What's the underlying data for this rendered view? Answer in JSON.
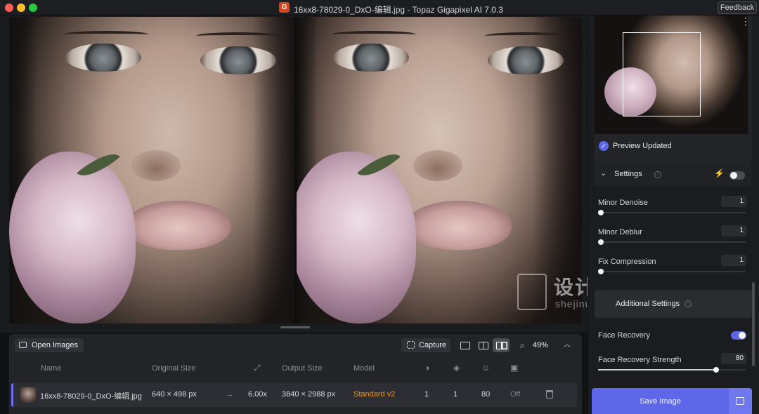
{
  "window": {
    "title": "16xx8-78029-0_DxO-编辑.jpg - Topaz Gigapixel AI 7.0.3",
    "app_logo_letter": "G",
    "feedback_label": "Feedback"
  },
  "toolbar": {
    "open_images_label": "Open Images",
    "capture_label": "Capture",
    "zoom_value": "49%",
    "view_modes": [
      "single-view",
      "split-view",
      "side-by-side"
    ],
    "active_view_mode": "side-by-side"
  },
  "table": {
    "columns": {
      "name": "Name",
      "original_size": "Original Size",
      "output_size": "Output Size",
      "model": "Model"
    },
    "column_icons": [
      "expand-arrows-icon",
      "denoise-icon",
      "deblur-icon",
      "face-icon",
      "compression-icon"
    ],
    "rows": [
      {
        "name": "16xx8-78029-0_DxO-编辑.jpg",
        "original_size": "640 × 498 px",
        "scale": "6.00x",
        "output_size": "3840 × 2988 px",
        "model": "Standard v2",
        "denoise": "1",
        "deblur": "1",
        "face": "80",
        "compression": "Off"
      }
    ]
  },
  "sidebar": {
    "preview_status": "Preview Updated",
    "settings": {
      "title": "Settings",
      "auto_toggle_on": false,
      "params": [
        {
          "label": "Minor Denoise",
          "value": "1",
          "level": 0.0
        },
        {
          "label": "Minor Deblur",
          "value": "1",
          "level": 0.0
        },
        {
          "label": "Fix Compression",
          "value": "1",
          "level": 0.0
        }
      ]
    },
    "additional_settings": {
      "title": "Additional Settings",
      "face_recovery_label": "Face Recovery",
      "face_recovery_on": true,
      "face_recovery_strength_label": "Face Recovery Strength",
      "face_recovery_strength_value": "80",
      "face_recovery_strength_level": 0.8
    },
    "save_label": "Save Image"
  },
  "watermark": {
    "text": "设计奴",
    "subtext": "shejinu.com"
  },
  "colors": {
    "accent": "#5d67e8",
    "model_text": "#e3962c",
    "background": "#111214"
  }
}
